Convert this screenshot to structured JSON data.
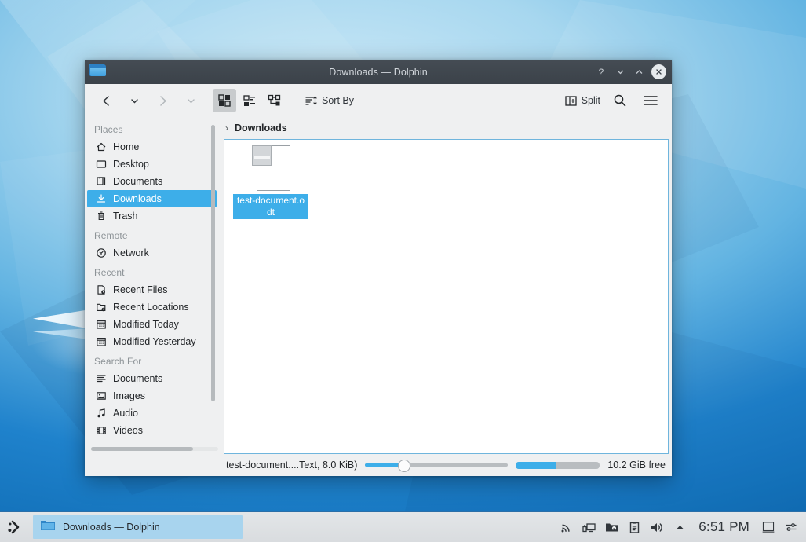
{
  "window": {
    "title": "Downloads — Dolphin",
    "app_icon": "folder-icon",
    "buttons": {
      "help": "?",
      "minimize": "minimize-icon",
      "maximize": "maximize-icon",
      "close": "✕"
    }
  },
  "toolbar": {
    "back_label": "‹",
    "back_dropdown": "⌄",
    "forward_label": "›",
    "forward_dropdown": "⌄",
    "view_modes": [
      {
        "name": "icons-view",
        "label": "Icons",
        "active": true
      },
      {
        "name": "compact-view",
        "label": "Compact",
        "active": false
      },
      {
        "name": "details-view",
        "label": "Details",
        "active": false
      }
    ],
    "sort_by_label": "Sort By",
    "split_label": "Split",
    "search_label": "Search",
    "menu_label": "Control"
  },
  "breadcrumb": {
    "separator": "›",
    "path": "Downloads"
  },
  "sidebar": {
    "sections": [
      {
        "title": "Places",
        "items": [
          {
            "label": "Home",
            "icon": "home-icon",
            "selected": false
          },
          {
            "label": "Desktop",
            "icon": "desktop-icon",
            "selected": false
          },
          {
            "label": "Documents",
            "icon": "documents-icon",
            "selected": false
          },
          {
            "label": "Downloads",
            "icon": "downloads-icon",
            "selected": true
          },
          {
            "label": "Trash",
            "icon": "trash-icon",
            "selected": false
          }
        ]
      },
      {
        "title": "Remote",
        "items": [
          {
            "label": "Network",
            "icon": "network-icon",
            "selected": false
          }
        ]
      },
      {
        "title": "Recent",
        "items": [
          {
            "label": "Recent Files",
            "icon": "recent-files-icon",
            "selected": false
          },
          {
            "label": "Recent Locations",
            "icon": "recent-locations-icon",
            "selected": false
          },
          {
            "label": "Modified Today",
            "icon": "calendar-icon",
            "selected": false
          },
          {
            "label": "Modified Yesterday",
            "icon": "calendar-icon",
            "selected": false
          }
        ]
      },
      {
        "title": "Search For",
        "items": [
          {
            "label": "Documents",
            "icon": "text-lines-icon",
            "selected": false
          },
          {
            "label": "Images",
            "icon": "image-icon",
            "selected": false
          },
          {
            "label": "Audio",
            "icon": "music-note-icon",
            "selected": false
          },
          {
            "label": "Videos",
            "icon": "film-icon",
            "selected": false
          }
        ]
      }
    ]
  },
  "files": [
    {
      "name": "test-document.odt",
      "icon": "odt-document-icon",
      "selected": true
    }
  ],
  "statusbar": {
    "selection_text": "test-document....Text, 8.0 KiB)",
    "zoom_percent": 26,
    "space_used_percent": 48,
    "free_space": "10.2 GiB free"
  },
  "taskbar": {
    "launcher_icon": "application-launcher-icon",
    "tasks": [
      {
        "label": "Downloads — Dolphin",
        "icon": "folder-icon",
        "active": true
      }
    ],
    "tray": [
      {
        "name": "network-signal-icon"
      },
      {
        "name": "network-device-icon"
      },
      {
        "name": "vault-icon"
      },
      {
        "name": "clipboard-icon"
      },
      {
        "name": "volume-icon"
      },
      {
        "name": "show-hidden-icon"
      }
    ],
    "clock": "6:51 PM",
    "right_icons": [
      {
        "name": "show-desktop-icon"
      },
      {
        "name": "settings-sliders-icon"
      }
    ]
  },
  "colors": {
    "accent": "#3daee9",
    "titlebar": "#3b4249",
    "chrome": "#eff0f1",
    "taskbar_border": "#2a6fa8"
  }
}
